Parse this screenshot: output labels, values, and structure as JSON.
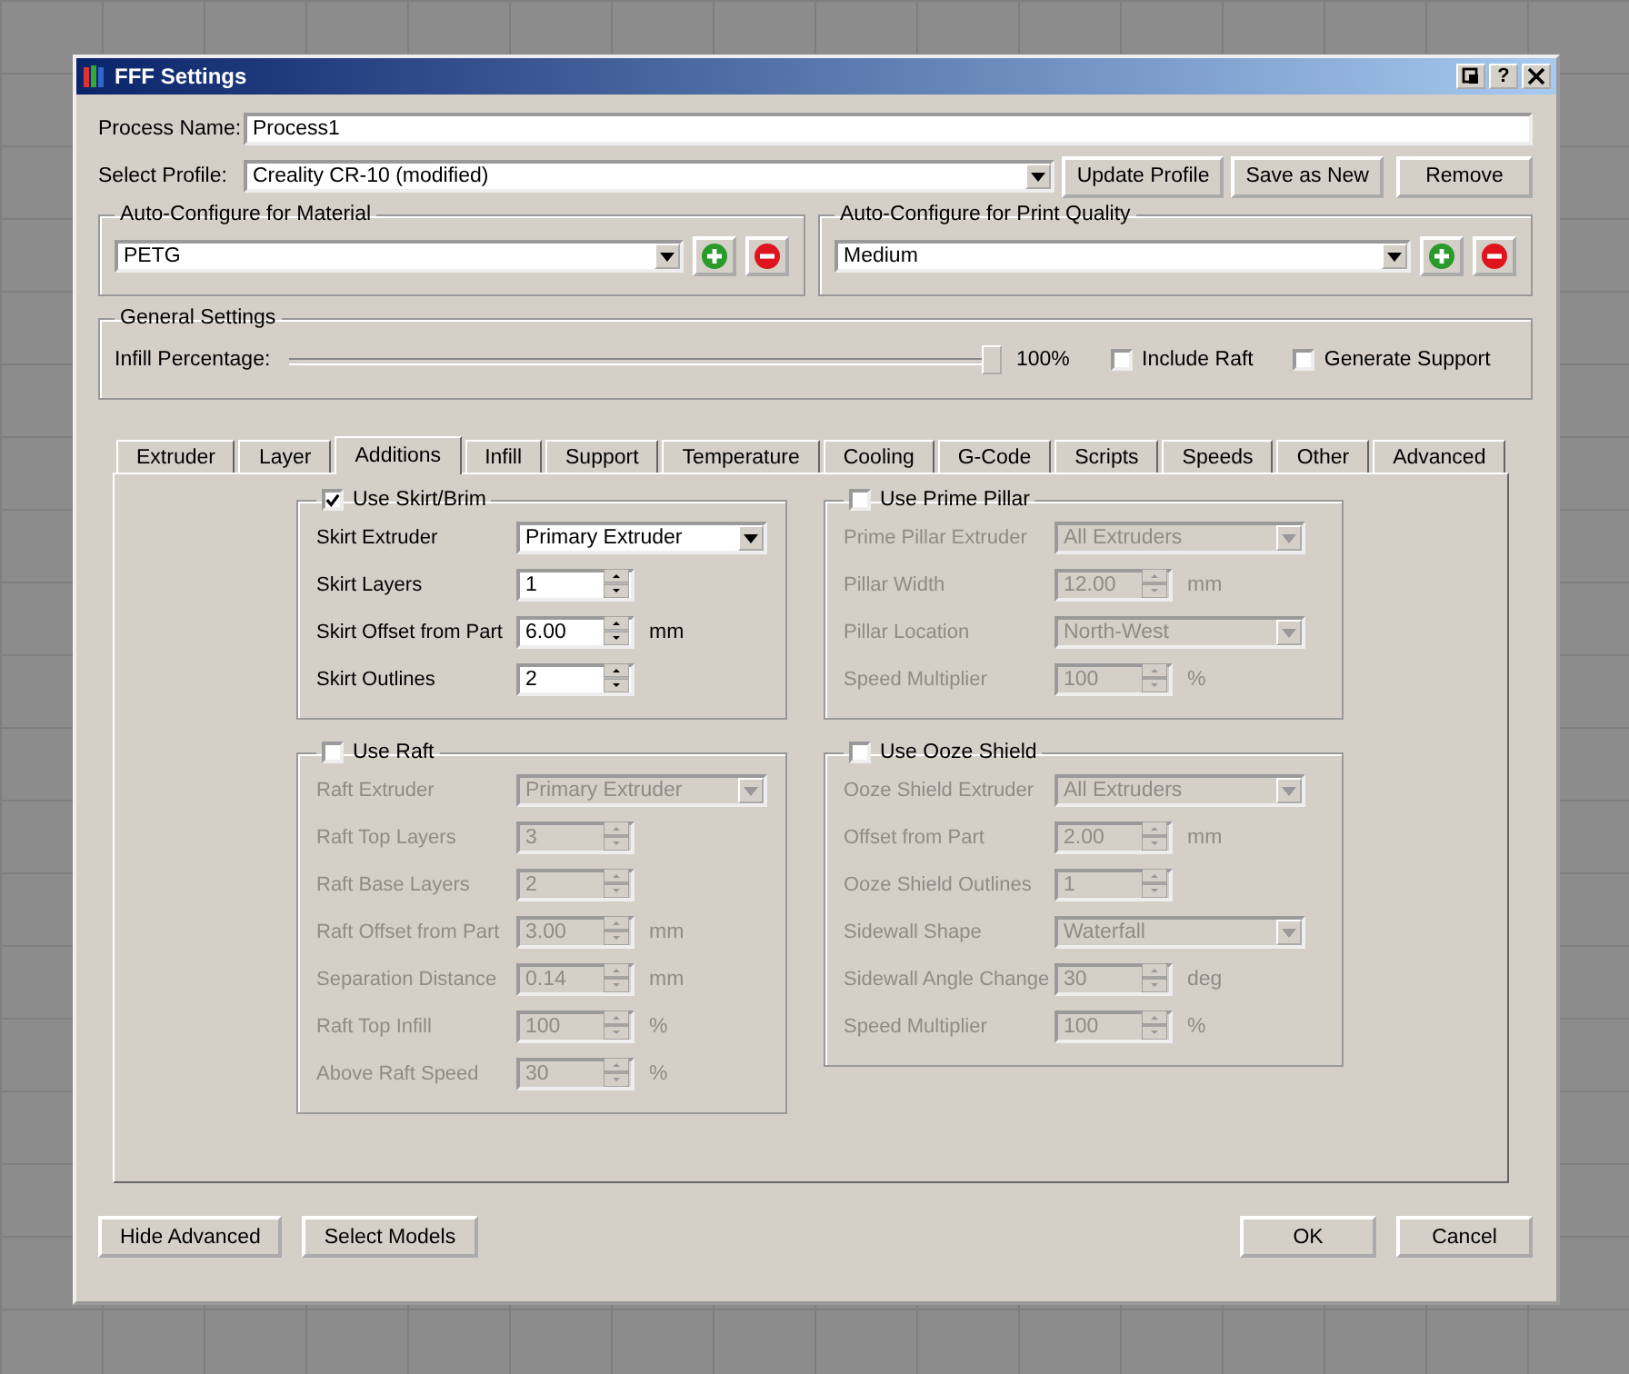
{
  "window": {
    "title": "FFF Settings",
    "help_button": "?"
  },
  "process_name": {
    "label": "Process Name:",
    "value": "Process1"
  },
  "profile": {
    "label": "Select Profile:",
    "value": "Creality CR-10 (modified)"
  },
  "profile_buttons": [
    "Update Profile",
    "Save as New",
    "Remove"
  ],
  "auto_configure": [
    {
      "title": "Auto-Configure for Material",
      "value": "PETG"
    },
    {
      "title": "Auto-Configure for Print Quality",
      "value": "Medium"
    }
  ],
  "general_settings": {
    "title": "General Settings",
    "label": "Infill Percentage:",
    "level": 1,
    "reading": "100%",
    "options": [
      {
        "label": "Include Raft",
        "checked": false
      },
      {
        "label": "Generate Support",
        "checked": false
      }
    ]
  },
  "tabs": [
    {
      "label": "Extruder",
      "selected": false
    },
    {
      "label": "Layer",
      "selected": false
    },
    {
      "label": "Additions",
      "selected": true
    },
    {
      "label": "Infill",
      "selected": false
    },
    {
      "label": "Support",
      "selected": false
    },
    {
      "label": "Temperature",
      "selected": false
    },
    {
      "label": "Cooling",
      "selected": false
    },
    {
      "label": "G-Code",
      "selected": false
    },
    {
      "label": "Scripts",
      "selected": false
    },
    {
      "label": "Speeds",
      "selected": false
    },
    {
      "label": "Other",
      "selected": false
    },
    {
      "label": "Advanced",
      "selected": false
    }
  ],
  "groups": [
    {
      "label": "Use Skirt/Brim",
      "checked": true,
      "rows": [
        {
          "kind": "select",
          "label": "Skirt Extruder",
          "value": "Primary Extruder"
        },
        {
          "kind": "spin",
          "label": "Skirt Layers",
          "value": "1"
        },
        {
          "kind": "spin",
          "label": "Skirt Offset from Part",
          "value": "6.00",
          "unit": "mm"
        },
        {
          "kind": "spin",
          "label": "Skirt Outlines",
          "value": "2"
        }
      ]
    },
    {
      "label": "Use Prime Pillar",
      "checked": false,
      "rows": [
        {
          "kind": "select",
          "label": "Prime Pillar Extruder",
          "value": "All Extruders"
        },
        {
          "kind": "spin",
          "label": "Pillar Width",
          "value": "12.00",
          "unit": "mm"
        },
        {
          "kind": "select",
          "label": "Pillar Location",
          "value": "North-West"
        },
        {
          "kind": "spin",
          "label": "Speed Multiplier",
          "value": "100",
          "unit": "%"
        }
      ]
    },
    {
      "label": "Use Raft",
      "checked": false,
      "rows": [
        {
          "kind": "select",
          "label": "Raft Extruder",
          "value": "Primary Extruder"
        },
        {
          "kind": "spin",
          "label": "Raft Top Layers",
          "value": "3"
        },
        {
          "kind": "spin",
          "label": "Raft Base Layers",
          "value": "2"
        },
        {
          "kind": "spin",
          "label": "Raft Offset from Part",
          "value": "3.00",
          "unit": "mm"
        },
        {
          "kind": "spin",
          "label": "Separation Distance",
          "value": "0.14",
          "unit": "mm"
        },
        {
          "kind": "spin",
          "label": "Raft Top Infill",
          "value": "100",
          "unit": "%"
        },
        {
          "kind": "spin",
          "label": "Above Raft Speed",
          "value": "30",
          "unit": "%"
        }
      ]
    },
    {
      "label": "Use Ooze Shield",
      "checked": false,
      "rows": [
        {
          "kind": "select",
          "label": "Ooze Shield Extruder",
          "value": "All Extruders"
        },
        {
          "kind": "spin",
          "label": "Offset from Part",
          "value": "2.00",
          "unit": "mm"
        },
        {
          "kind": "spin",
          "label": "Ooze Shield Outlines",
          "value": "1"
        },
        {
          "kind": "select",
          "label": "Sidewall Shape",
          "value": "Waterfall"
        },
        {
          "kind": "spin",
          "label": "Sidewall Angle Change",
          "value": "30",
          "unit": "deg"
        },
        {
          "kind": "spin",
          "label": "Speed Multiplier",
          "value": "100",
          "unit": "%"
        }
      ]
    }
  ],
  "footer_left": [
    "Hide Advanced",
    "Select Models"
  ],
  "footer_right": [
    "OK",
    "Cancel"
  ]
}
